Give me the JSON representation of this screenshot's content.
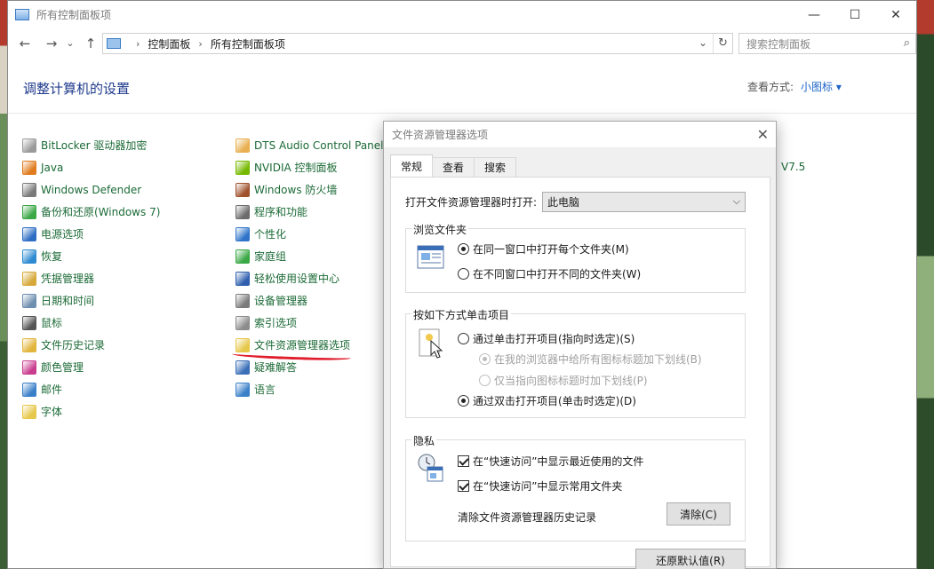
{
  "window": {
    "title": "所有控制面板项",
    "minimize": "—",
    "maximize": "☐",
    "close": "✕"
  },
  "nav": {
    "back": "←",
    "forward": "→",
    "history": "⌄",
    "up": "↑"
  },
  "address": {
    "crumbs": [
      "控制面板",
      "所有控制面板项"
    ],
    "separator": "›",
    "dropdown": "⌄",
    "refresh": "↻"
  },
  "search": {
    "placeholder": "搜索控制面板",
    "icon": "⌕"
  },
  "page_title": "调整计算机的设置",
  "view_by": {
    "label": "查看方式:",
    "value": "小图标 ▾"
  },
  "col1": [
    {
      "label": "BitLocker 驱动器加密",
      "icon": "bitlocker-icon",
      "color": "#9a9a9a"
    },
    {
      "label": "Java",
      "icon": "java-icon",
      "color": "#e07b1e"
    },
    {
      "label": "Windows Defender",
      "icon": "defender-icon",
      "color": "#7a7a7a"
    },
    {
      "label": "备份和还原(Windows 7)",
      "icon": "backup-icon",
      "color": "#3aa845"
    },
    {
      "label": "电源选项",
      "icon": "power-icon",
      "color": "#2d6ec4"
    },
    {
      "label": "恢复",
      "icon": "recovery-icon",
      "color": "#2e8bd1"
    },
    {
      "label": "凭据管理器",
      "icon": "credential-icon",
      "color": "#d6a93a"
    },
    {
      "label": "日期和时间",
      "icon": "datetime-icon",
      "color": "#6f8fb0"
    },
    {
      "label": "鼠标",
      "icon": "mouse-icon",
      "color": "#555555"
    },
    {
      "label": "文件历史记录",
      "icon": "file-history-icon",
      "color": "#e2b53c"
    },
    {
      "label": "颜色管理",
      "icon": "color-icon",
      "color": "#c93d8f"
    },
    {
      "label": "邮件",
      "icon": "mail-icon",
      "color": "#3a80c9"
    },
    {
      "label": "字体",
      "icon": "font-icon",
      "color": "#e6c84a"
    }
  ],
  "col2": [
    {
      "label": "DTS Audio Control Panel",
      "icon": "dts-icon",
      "color": "#e8b050"
    },
    {
      "label": "NVIDIA 控制面板",
      "icon": "nvidia-icon",
      "color": "#76b900"
    },
    {
      "label": "Windows 防火墙",
      "icon": "firewall-icon",
      "color": "#a0522d"
    },
    {
      "label": "程序和功能",
      "icon": "programs-icon",
      "color": "#6c6c6c"
    },
    {
      "label": "个性化",
      "icon": "personalize-icon",
      "color": "#2f74c9"
    },
    {
      "label": "家庭组",
      "icon": "homegroup-icon",
      "color": "#3aa845"
    },
    {
      "label": "轻松使用设置中心",
      "icon": "ease-of-access-icon",
      "color": "#2f5fae"
    },
    {
      "label": "设备管理器",
      "icon": "device-manager-icon",
      "color": "#7b7b7b"
    },
    {
      "label": "索引选项",
      "icon": "indexing-icon",
      "color": "#8c8c8c"
    },
    {
      "label": "文件资源管理器选项",
      "icon": "folder-options-icon",
      "color": "#e6c84a"
    },
    {
      "label": "疑难解答",
      "icon": "troubleshoot-icon",
      "color": "#3a6fb8"
    },
    {
      "label": "语言",
      "icon": "language-icon",
      "color": "#3a80c9"
    }
  ],
  "cut_text": "V7.5",
  "dialog": {
    "title": "文件资源管理器选项",
    "close": "✕",
    "tabs": [
      "常规",
      "查看",
      "搜索"
    ],
    "open_label": "打开文件资源管理器时打开:",
    "open_value": "此电脑",
    "browse": {
      "legend": "浏览文件夹",
      "opt1": "在同一窗口中打开每个文件夹(M)",
      "opt2": "在不同窗口中打开不同的文件夹(W)"
    },
    "click": {
      "legend": "按如下方式单击项目",
      "opt_single": "通过单击打开项目(指向时选定)(S)",
      "sub1": "在我的浏览器中给所有图标标题加下划线(B)",
      "sub2": "仅当指向图标标题时加下划线(P)",
      "opt_double": "通过双击打开项目(单击时选定)(D)"
    },
    "privacy": {
      "legend": "隐私",
      "check1": "在“快速访问”中显示最近使用的文件",
      "check2": "在“快速访问”中显示常用文件夹",
      "clear_label": "清除文件资源管理器历史记录",
      "clear_button": "清除(C)"
    },
    "restore_button": "还原默认值(R)"
  }
}
